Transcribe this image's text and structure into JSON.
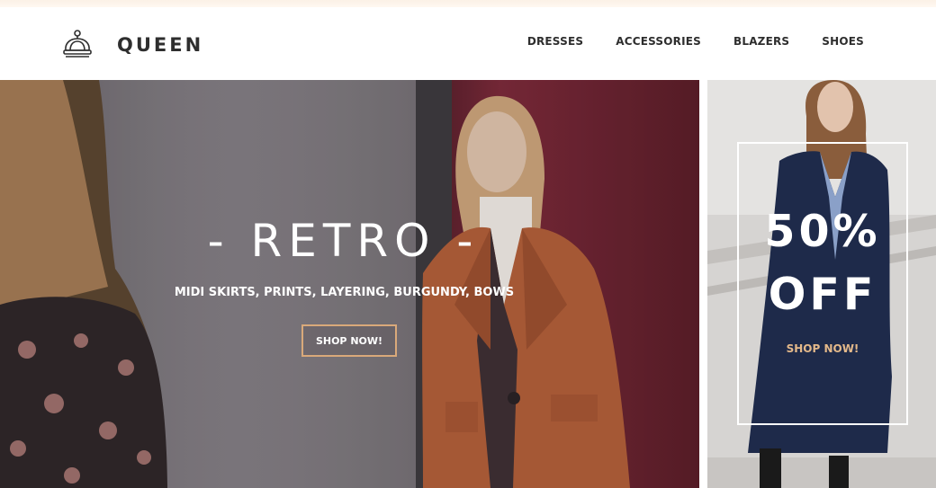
{
  "brand": {
    "name": "QUEEN",
    "logo_icon": "crown-icon"
  },
  "nav": {
    "items": [
      {
        "label": "DRESSES"
      },
      {
        "label": "ACCESSORIES"
      },
      {
        "label": "BLAZERS"
      },
      {
        "label": "SHOES"
      }
    ]
  },
  "hero": {
    "title": "- RETRO -",
    "subtitle": "MIDI SKIRTS, PRINTS, LAYERING, BURGUNDY, BOWS",
    "button_label": "SHOP NOW!",
    "button_border_color": "#d9a97a"
  },
  "promo": {
    "title_line1": "50%",
    "title_line2": "OFF",
    "button_label": "SHOP NOW!",
    "button_color": "#e4b98a"
  }
}
